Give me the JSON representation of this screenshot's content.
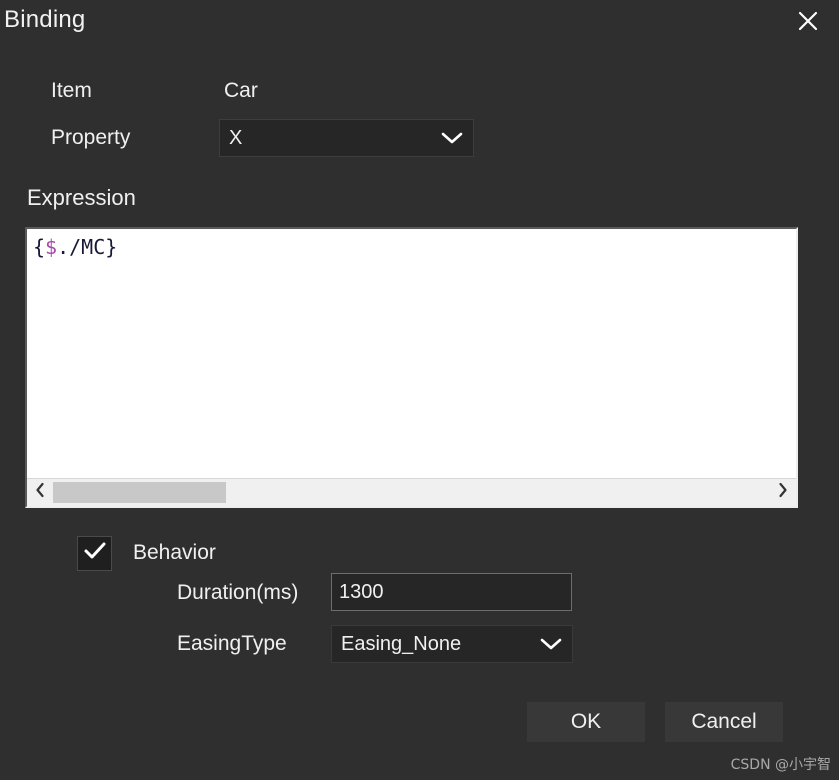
{
  "dialog": {
    "title": "Binding",
    "close_icon": "close-icon"
  },
  "fields": {
    "item_label": "Item",
    "item_value": "Car",
    "property_label": "Property",
    "property_value": "X",
    "property_chevron_icon": "chevron-down-icon"
  },
  "expression": {
    "label": "Expression",
    "value": "{$./MC}",
    "tokens": {
      "open": "{",
      "dollar": "$",
      "rest": "./MC}"
    },
    "scroll_left_icon": "chevron-left-icon",
    "scroll_right_icon": "chevron-right-icon"
  },
  "behavior": {
    "label": "Behavior",
    "checked": true,
    "check_icon": "checkmark-icon",
    "duration_label": "Duration(ms)",
    "duration_value": "1300",
    "duration_placeholder": "",
    "easing_label": "EasingType",
    "easing_value": "Easing_None",
    "easing_chevron_icon": "chevron-down-icon"
  },
  "buttons": {
    "ok": "OK",
    "cancel": "Cancel"
  },
  "watermark": "CSDN @小宇智",
  "colors": {
    "background": "#2f2f2f",
    "input_background": "#262626",
    "text": "#f0f0f0",
    "expression_background": "#ffffff",
    "token_dollar": "#a64ca6",
    "token_plain": "#181838",
    "scrollbar_thumb": "#c8c8c8"
  }
}
